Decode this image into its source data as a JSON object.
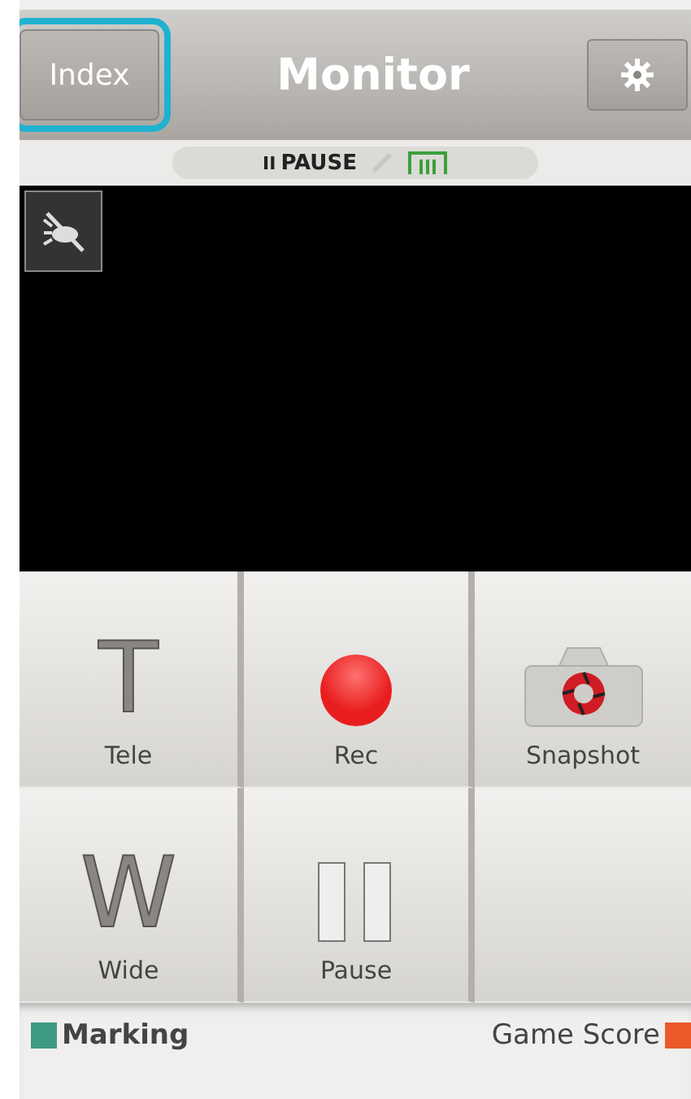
{
  "header": {
    "index_button": {
      "label": "Index",
      "highlighted": true
    },
    "title": "Monitor"
  },
  "status": {
    "pause_icon": "II",
    "label": "PAUSE"
  },
  "controls": [
    {
      "kind": "letter",
      "glyph": "T",
      "label": "Tele"
    },
    {
      "kind": "record",
      "label": "Rec"
    },
    {
      "kind": "camera",
      "label": "Snapshot"
    },
    {
      "kind": "letter",
      "glyph": "W",
      "label": "Wide"
    },
    {
      "kind": "pause",
      "label": "Pause"
    },
    {
      "kind": "empty"
    }
  ],
  "footer": [
    {
      "label": "Marking",
      "color": "#3f9a85"
    },
    {
      "label": "Game Score",
      "color": "#ea5a2a"
    }
  ]
}
